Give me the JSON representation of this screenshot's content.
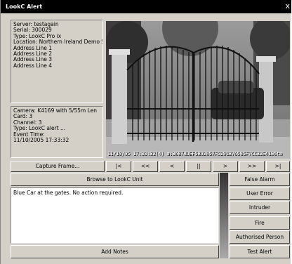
{
  "window": {
    "title": "LookC Alert",
    "close_glyph": "x"
  },
  "server_info": [
    "Server: testagain",
    "Serial: 300029",
    "Type: LookC Pro ix",
    "Location: Northern Ireland Demo Site",
    "Address Line 1",
    "Address Line 2",
    "Address Line 3",
    "Address Line 4"
  ],
  "camera_info": [
    "Camera: K4169 with 5/55m Len",
    "Card: 3",
    "Channel: 3",
    "Type: LookC alert ...",
    "Event Time:",
    "11/10/2005 17:33:32"
  ],
  "video": {
    "overlay_text": "11/10/05 17:33:32(4) a:36878DEF5B92057F5291B76505F7CC32E4106ta"
  },
  "playback": {
    "capture_label": "Capture Frame...",
    "controls": [
      "|<",
      "<<",
      "<",
      "||",
      ">",
      ">>",
      ">|"
    ]
  },
  "browse_label": "Browse to LookC Unit",
  "notes": {
    "text": "Blue Car at the gates. No action required.",
    "add_label": "Add Notes"
  },
  "alarm_buttons": [
    "False Alarm",
    "User Error",
    "Intruder",
    "Fire",
    "Authorised Person",
    "Test Alert"
  ]
}
